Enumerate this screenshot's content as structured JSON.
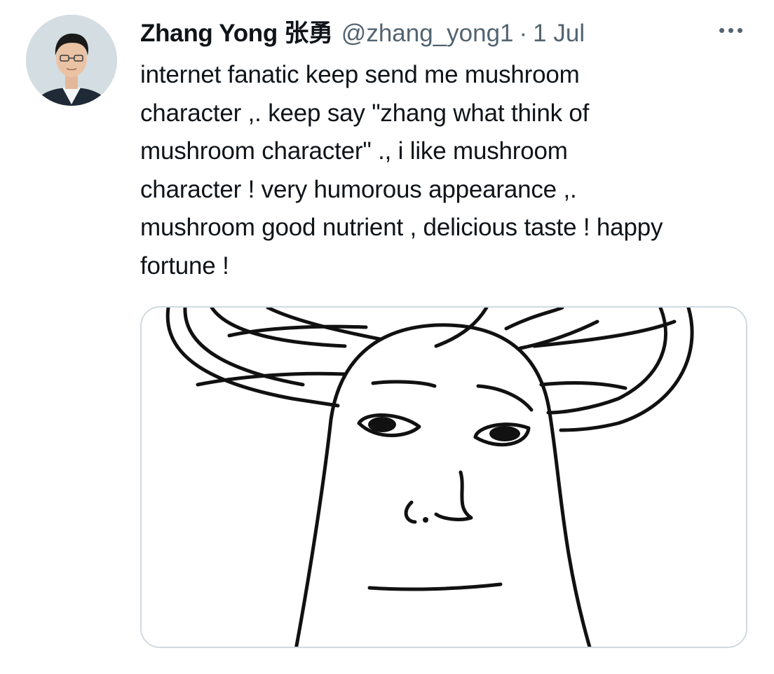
{
  "tweet": {
    "author_name": "Zhang Yong 张勇",
    "handle": "@zhang_yong1",
    "separator": "·",
    "date": "1 Jul",
    "text": "internet fanatic keep send me mushroom\ncharacter ,. keep say \"zhang what think of\nmushroom character\" ., i like mushroom\ncharacter ! very humorous appearance ,.\nmushroom good nutrient , delicious taste ! happy\nfortune !",
    "more_icon": "more-horizontal-icon",
    "media_description_icon": "mushroom-character-drawing"
  },
  "colors": {
    "text": "#0f1419",
    "secondary": "#536471",
    "border": "#cfd9de"
  }
}
